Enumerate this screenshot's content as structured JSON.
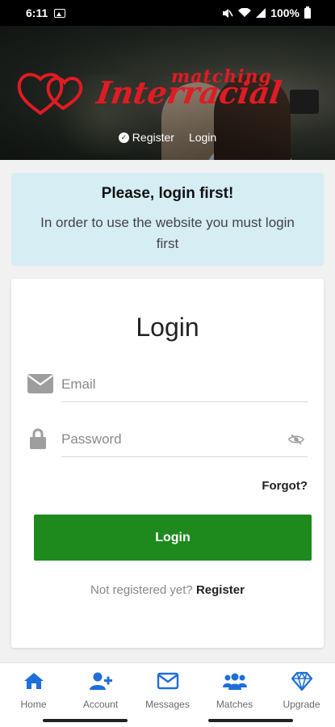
{
  "status_bar": {
    "time": "6:11",
    "battery": "100%"
  },
  "header": {
    "logo_small": "matching",
    "logo_big": "Interracial",
    "nav": {
      "register": "Register",
      "login": "Login"
    }
  },
  "alert": {
    "title": "Please, login first!",
    "text": "In order to use the website you must login first"
  },
  "login_form": {
    "title": "Login",
    "email_placeholder": "Email",
    "password_placeholder": "Password",
    "forgot": "Forgot?",
    "submit": "Login",
    "not_registered": "Not registered yet?",
    "register": "Register"
  },
  "bottom_nav": [
    {
      "label": "Home",
      "icon": "home-icon"
    },
    {
      "label": "Account",
      "icon": "add-user-icon"
    },
    {
      "label": "Messages",
      "icon": "envelope-icon"
    },
    {
      "label": "Matches",
      "icon": "users-icon"
    },
    {
      "label": "Upgrade",
      "icon": "diamond-icon"
    }
  ],
  "colors": {
    "accent": "#1e6fd9",
    "button_green": "#1e8a1e",
    "logo_red": "#e01b24",
    "alert_bg": "#d5edf3"
  }
}
